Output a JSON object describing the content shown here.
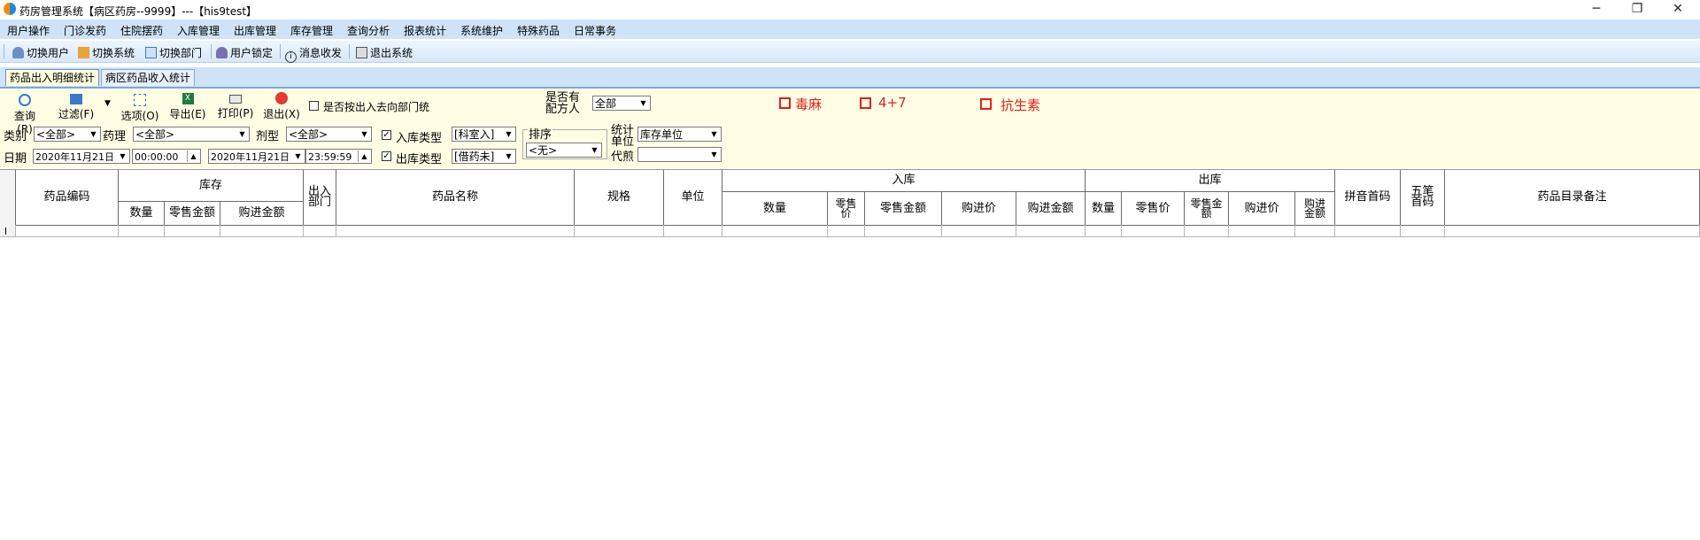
{
  "window": {
    "title": "药房管理系统【病区药房--9999】---【his9test】",
    "minimize": "─",
    "restore": "❐",
    "close": "✕"
  },
  "menu": [
    "用户操作",
    "门诊发药",
    "住院摆药",
    "入库管理",
    "出库管理",
    "库存管理",
    "查询分析",
    "报表统计",
    "系统维护",
    "特殊药品",
    "日常事务"
  ],
  "toolbar": [
    "切换用户",
    "切换系统",
    "切换部门",
    "用户锁定",
    "消息收发",
    "退出系统"
  ],
  "tabs": [
    "药品出入明细统计",
    "病区药品收入统计"
  ],
  "actions": {
    "query": "查询(R)",
    "filter": "过滤(F)",
    "options": "选项(O)",
    "export": "导出(E)",
    "print": "打印(P)",
    "exit": "退出(X)",
    "by_dept": "是否按出入去向部门统"
  },
  "prescription": {
    "label_line1": "是否有",
    "label_line2": "配方人",
    "value": "全部"
  },
  "special": {
    "narcotic": "毒麻",
    "four_plus_seven": "4+7",
    "antibiotic": "抗生素"
  },
  "filters": {
    "category_label": "类别",
    "category_value": "<全部>",
    "pharm_label": "药理",
    "pharm_value": "<全部>",
    "dosage_label": "剂型",
    "dosage_value": "<全部>",
    "in_type_label": "入库类型",
    "in_type_value": "[科室入]",
    "out_type_label": "出库类型",
    "out_type_value": "[借药未]",
    "sort_label": "排序",
    "sort_value": "<无>",
    "unit_label_1": "统计",
    "unit_label_2": "单位",
    "unit_value": "库存单位",
    "agent_label": "代煎",
    "agent_value": "",
    "date_label": "日期",
    "date_from": "2020年11月21日",
    "time_from": "00:00:00",
    "date_to": "2020年11月21日",
    "time_to": "23:59:59"
  },
  "grid": {
    "drug_code": "药品编码",
    "stock": "库存",
    "stock_qty": "数量",
    "stock_retail": "零售金额",
    "stock_purchase": "购进金额",
    "in_out_dept": "出入部门",
    "drug_name": "药品名称",
    "spec": "规格",
    "unit": "单位",
    "in": "入库",
    "in_qty": "数量",
    "in_retail_price": "零售价",
    "in_retail_amt": "零售金额",
    "in_purchase_price": "购进价",
    "in_purchase_amt": "购进金额",
    "out": "出库",
    "out_qty": "数量",
    "out_retail_price": "零售价",
    "out_retail_amt": "零售金额",
    "out_purchase_price": "购进价",
    "out_purchase_amt": "购进金额",
    "pinyin": "拼音首码",
    "wubi": "五笔首码",
    "remark": "药品目录备注"
  },
  "colors": {
    "menu_bg": "#cfe3f8",
    "panel_bg": "#fffde4",
    "red": "#e02020"
  }
}
